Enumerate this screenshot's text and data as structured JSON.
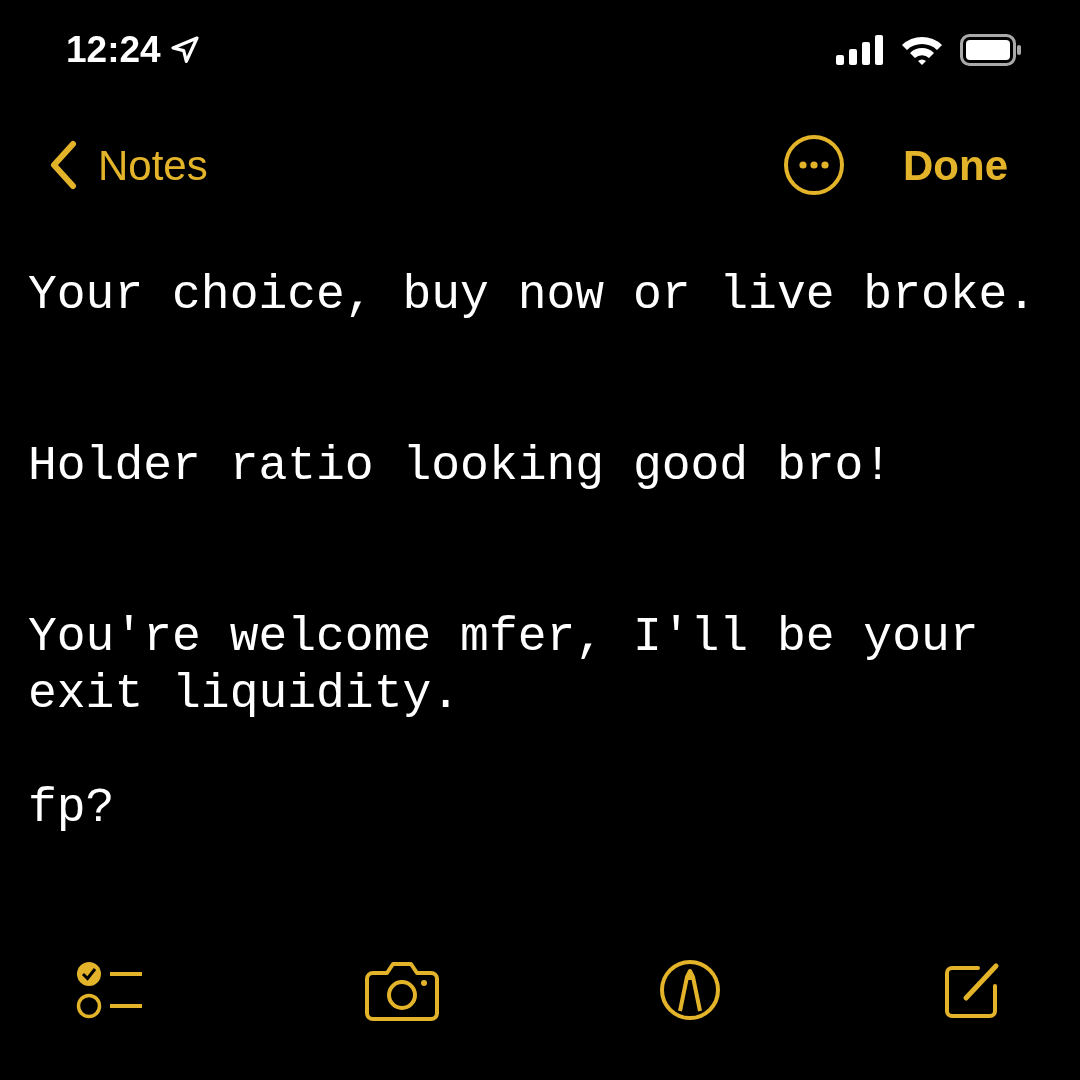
{
  "status_bar": {
    "time": "12:24"
  },
  "nav": {
    "back_label": "Notes",
    "done_label": "Done"
  },
  "note": {
    "paragraphs": [
      "Your choice, buy now or live broke.",
      "Holder ratio looking good bro!",
      "You're welcome mfer, I'll be your exit liquidity.",
      "fp?"
    ]
  }
}
